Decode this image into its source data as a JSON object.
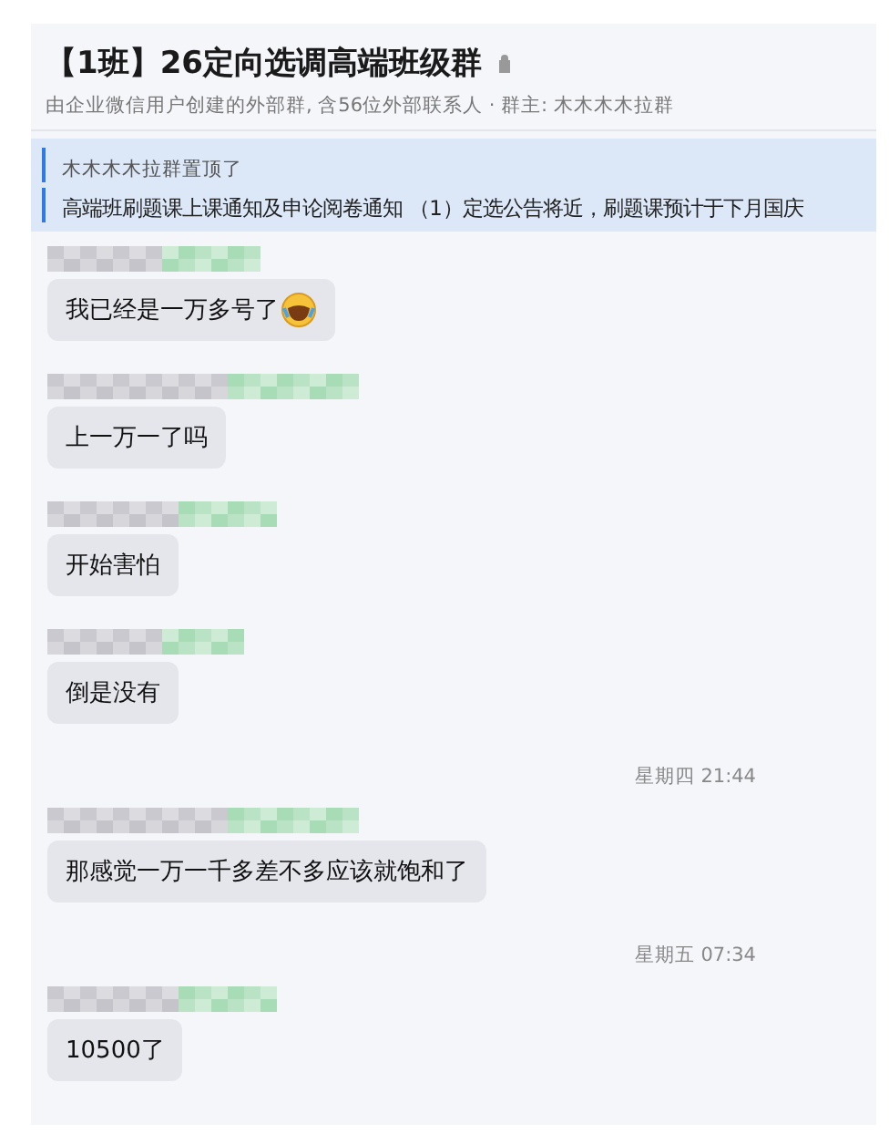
{
  "header": {
    "title": "【1班】26定向选调高端班级群",
    "subtitle": "由企业微信用户创建的外部群, 含56位外部联系人 · 群主: 木木木木拉群"
  },
  "pinned": {
    "by": "木木木木拉群置顶了",
    "text": "高端班刷题课上课通知及申论阅卷通知 （1）定选公告将近，刷题课预计于下月国庆"
  },
  "messages": [
    {
      "kind": "message",
      "text": "我已经是一万多号了",
      "emoji": true
    },
    {
      "kind": "message",
      "text": "上一万一了吗",
      "emoji": false
    },
    {
      "kind": "message",
      "text": "开始害怕",
      "emoji": false
    },
    {
      "kind": "message",
      "text": "倒是没有",
      "emoji": false
    },
    {
      "kind": "time",
      "text": "星期四 21:44"
    },
    {
      "kind": "message",
      "text": "那感觉一万一千多差不多应该就饱和了",
      "emoji": false
    },
    {
      "kind": "time",
      "text": "星期五 07:34"
    },
    {
      "kind": "message",
      "text": "10500了",
      "emoji": false
    }
  ]
}
